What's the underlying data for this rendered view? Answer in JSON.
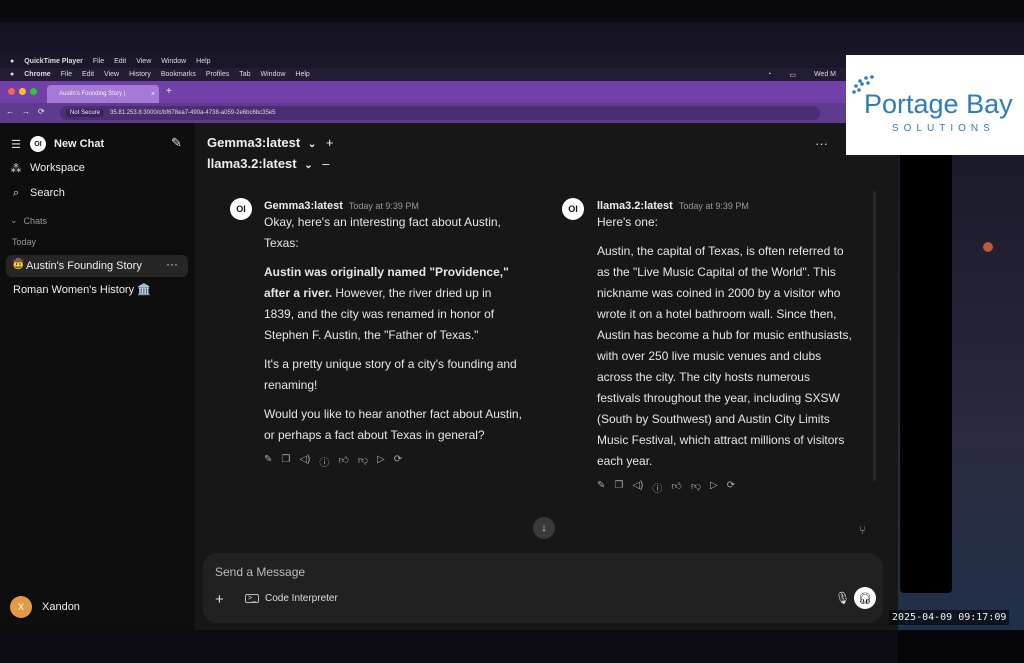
{
  "macos_qt_menu": {
    "app": "QuickTime Player",
    "items": [
      "File",
      "Edit",
      "View",
      "Window",
      "Help"
    ]
  },
  "macos_chrome_menu": {
    "app": "Chrome",
    "items": [
      "File",
      "Edit",
      "View",
      "History",
      "Bookmarks",
      "Profiles",
      "Tab",
      "Window",
      "Help"
    ],
    "clock": "Wed M"
  },
  "browser": {
    "tab_title": "Austin's Founding Story | ",
    "not_secure": "Not Secure",
    "url": "35.81.253.8:3000/c/bf678ea7-490a-4738-a059-2e6bc6bc35e5"
  },
  "sidebar": {
    "new_chat": "New Chat",
    "workspace": "Workspace",
    "search": "Search",
    "chats_header": "Chats",
    "today": "Today",
    "items": [
      {
        "label": "Austin's Founding Story",
        "emoji": "🤠"
      },
      {
        "label": "Roman Women's History 🏛️"
      }
    ],
    "user_initial": "X",
    "user_name": "Xandon"
  },
  "models": {
    "first": "Gemma3:latest",
    "second": "llama3.2:latest"
  },
  "responses": [
    {
      "model": "Gemma3:latest",
      "time": "Today at 9:39 PM",
      "p1": "Okay, here's an interesting fact about Austin, Texas:",
      "p2_bold": "Austin was originally named \"Providence,\" after a river.",
      "p2_rest": " However, the river dried up in 1839, and the city was renamed in honor of Stephen F. Austin, the \"Father of Texas.\"",
      "p3": "It's a pretty unique story of a city's founding and renaming!",
      "p4": "Would you like to hear another fact about Austin, or perhaps a fact about Texas in general?"
    },
    {
      "model": "llama3.2:latest",
      "time": "Today at 9:39 PM",
      "p1": "Here's one:",
      "p2": "Austin, the capital of Texas, is often referred to as the \"Live Music Capital of the World\". This nickname was coined in 2000 by a visitor who wrote it on a hotel bathroom wall. Since then, Austin has become a hub for music enthusiasts, with over 250 live music venues and clubs across the city. The city hosts numerous festivals throughout the year, including SXSW (South by Southwest) and Austin City Limits Music Festival, which attract millions of visitors each year."
    }
  ],
  "input": {
    "placeholder": "Send a Message",
    "code_interpreter": "Code Interpreter"
  },
  "logo": {
    "title": "Portage Bay",
    "subtitle": "SOLUTIONS",
    "color": "#2d7db6"
  },
  "timestamp": "2025-04-09 09:17:09",
  "icons": [
    "menu-icon",
    "compose-icon",
    "workspace-icon",
    "search-icon",
    "edit-icon",
    "copy-icon",
    "speaker-icon",
    "info-icon",
    "thumbs-up-icon",
    "thumbs-down-icon",
    "play-icon",
    "regenerate-icon",
    "arrow-down-icon",
    "mic-icon",
    "headphones-icon"
  ]
}
